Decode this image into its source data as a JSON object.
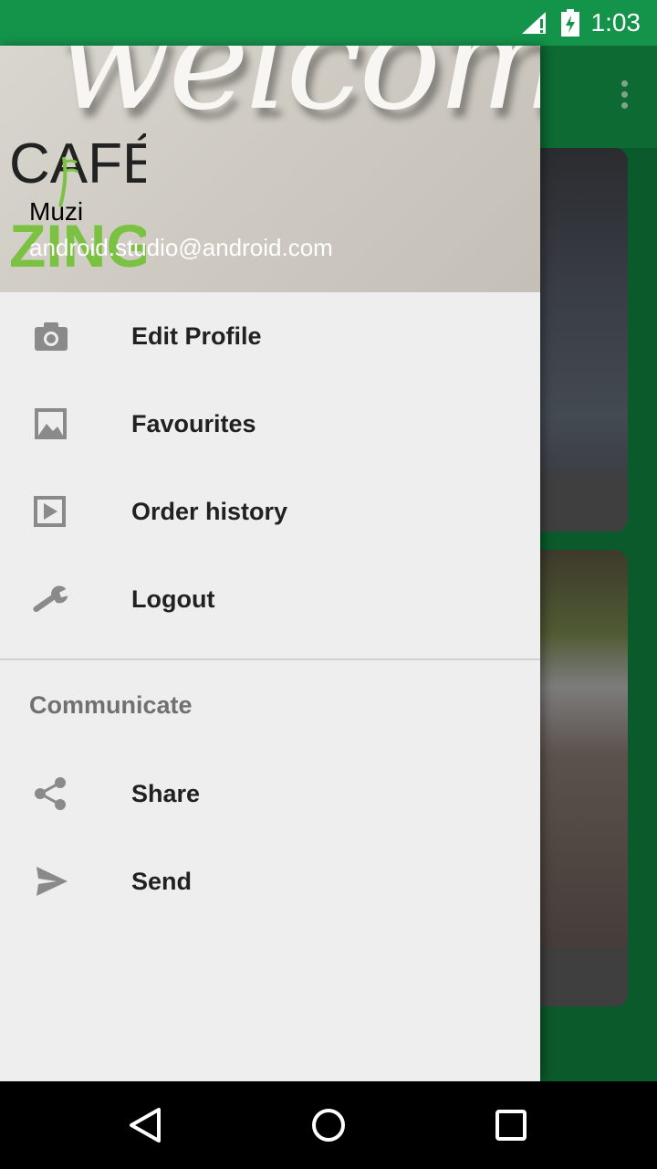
{
  "status_bar": {
    "time": "1:03"
  },
  "header": {
    "logo_text_top": "CAFÉ",
    "logo_text_bottom": "ZING!",
    "background_text": "welcome",
    "user_name": "Muzi",
    "user_email": "android.studio@android.com"
  },
  "menu": {
    "items": [
      {
        "label": "Edit Profile",
        "icon": "camera-icon"
      },
      {
        "label": "Favourites",
        "icon": "image-icon"
      },
      {
        "label": "Order history",
        "icon": "play-icon"
      },
      {
        "label": "Logout",
        "icon": "wrench-icon"
      }
    ],
    "section_title": "Communicate",
    "section_items": [
      {
        "label": "Share",
        "icon": "share-icon"
      },
      {
        "label": "Send",
        "icon": "send-icon"
      }
    ]
  },
  "colors": {
    "status_bar": "#14934a",
    "toolbar": "#0d6a33",
    "drawer_bg": "#eeeeee",
    "logo_green": "#7bc142"
  }
}
